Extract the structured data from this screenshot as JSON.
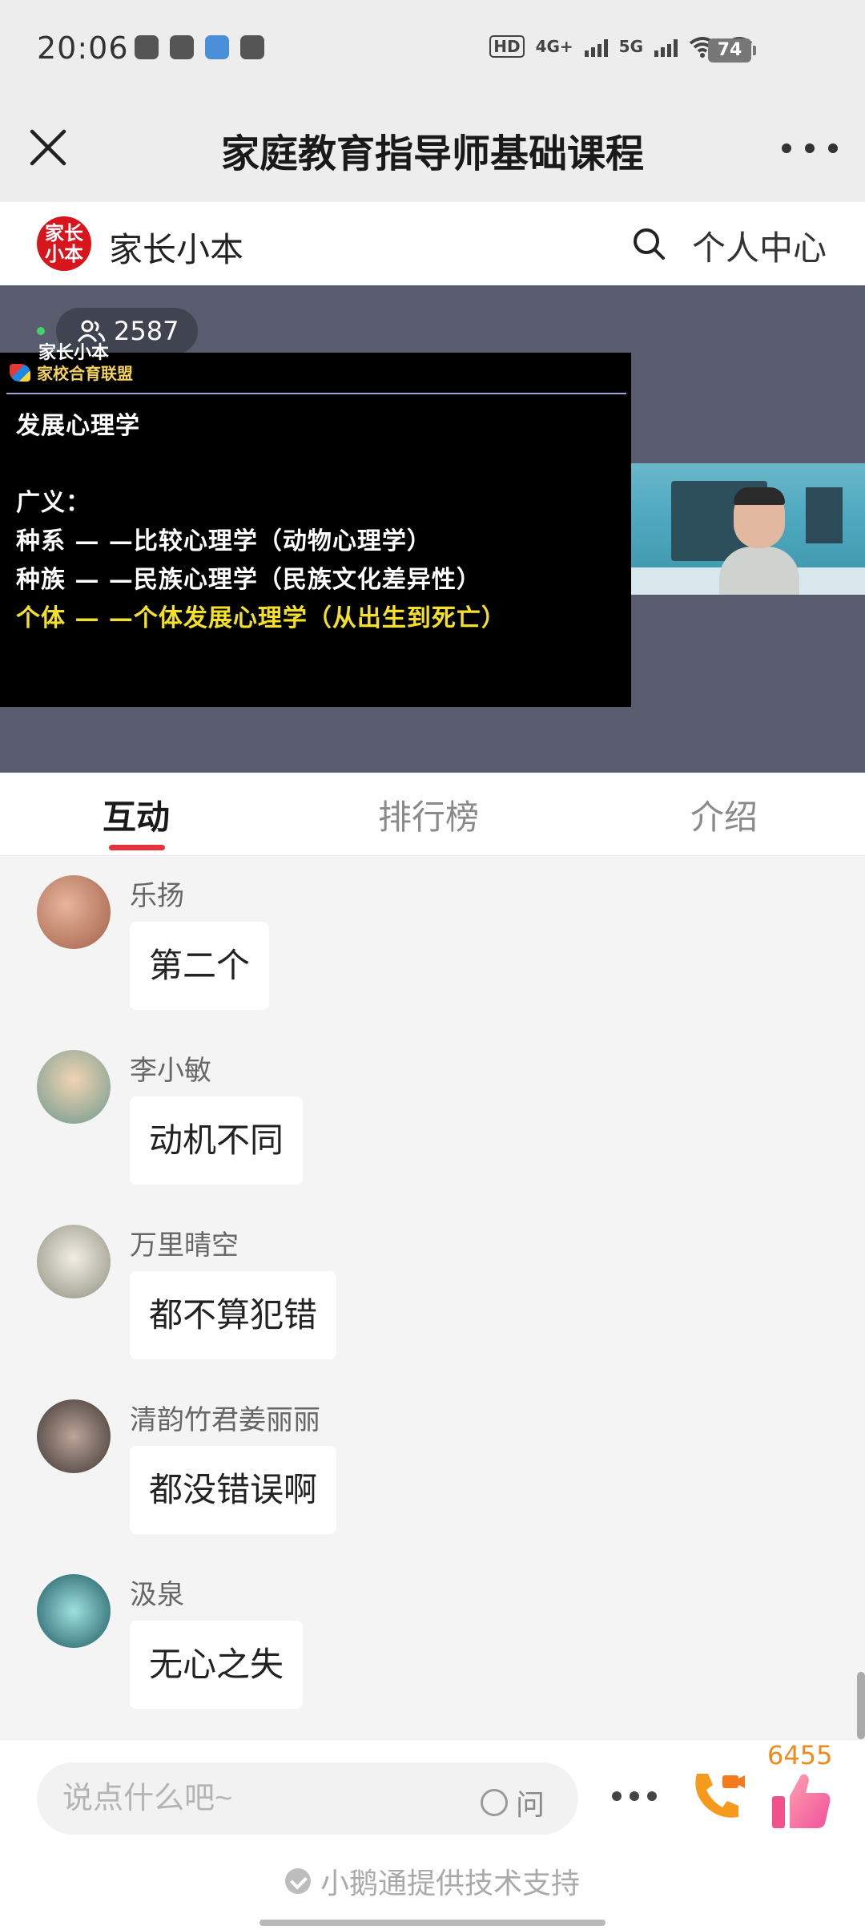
{
  "status_bar": {
    "time": "20:06",
    "network_hd": "HD",
    "network_4g": "4G+",
    "network_5g": "5G",
    "battery": "74",
    "app_icons": [
      "wechat-icon",
      "tiktok-icon",
      "chat-icon",
      "gamepad-icon"
    ]
  },
  "header": {
    "title": "家庭教育指导师基础课程",
    "close_icon": "close-icon",
    "more_icon": "more-icon"
  },
  "brand": {
    "logo_text_line1": "家长",
    "logo_text_line2": "小本",
    "name": "家长小本",
    "search_icon": "search-icon",
    "personal_center": "个人中心"
  },
  "live": {
    "viewer_count": "2587",
    "watermark": "家长小本",
    "slide": {
      "logo_text": "家校合育联盟",
      "title": "发展心理学",
      "line_label": "广义：",
      "line_1": "种系 — —比较心理学（动物心理学）",
      "line_2": "种族 — —民族心理学（民族文化差异性）",
      "line_3": "个体 — —个体发展心理学（从出生到死亡）"
    }
  },
  "tabs": [
    {
      "label": "互动",
      "active": true
    },
    {
      "label": "排行榜",
      "active": false
    },
    {
      "label": "介绍",
      "active": false
    }
  ],
  "messages": [
    {
      "name": "乐扬",
      "text": "第二个",
      "avatar_color": "#c8866e"
    },
    {
      "name": "李小敏",
      "text": "动机不同",
      "avatar_color": "#8fb3a8"
    },
    {
      "name": "万里晴空",
      "text": "都不算犯错",
      "avatar_color": "#b7b9a9"
    },
    {
      "name": "清韵竹君姜丽丽",
      "text": "都没错误啊",
      "avatar_color": "#7d6c68"
    },
    {
      "name": "汲泉",
      "text": "无心之失",
      "avatar_color": "#2e7d86"
    }
  ],
  "bottom_bar": {
    "input_placeholder": "说点什么吧~",
    "ask_label": "问",
    "like_count": "6455",
    "powered_by": "小鹅通提供技术支持"
  }
}
